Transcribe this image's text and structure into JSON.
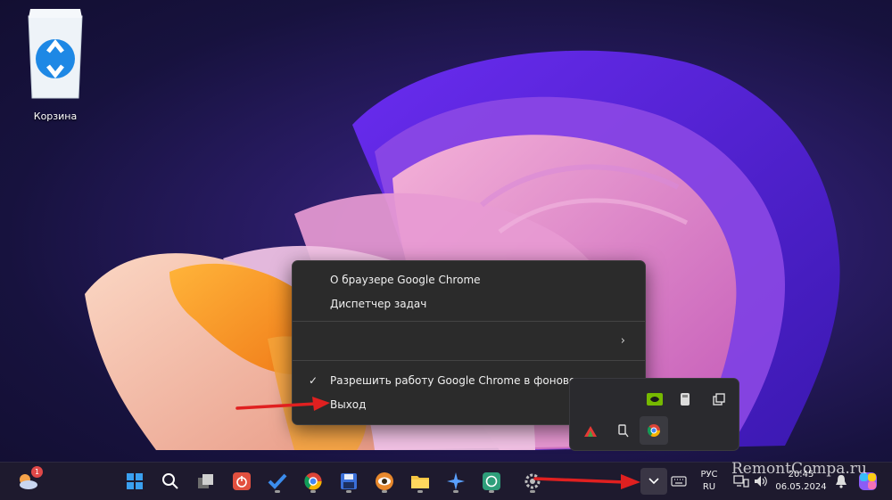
{
  "desktop": {
    "recycle_bin_label": "Корзина"
  },
  "context_menu": {
    "items": [
      "О браузере Google Chrome",
      "Диспетчер задач",
      "Разрешить работу Google Chrome в фоновом режиме",
      "Выход"
    ],
    "background_mode_checked": true,
    "submenu_chevron": "›"
  },
  "taskbar": {
    "weather_badge": "1",
    "language_top": "РУС",
    "language_bottom": "RU",
    "time": "20:45",
    "date": "06.05.2024",
    "accent": "#0078d4"
  },
  "watermark": "RemontCompa.ru"
}
